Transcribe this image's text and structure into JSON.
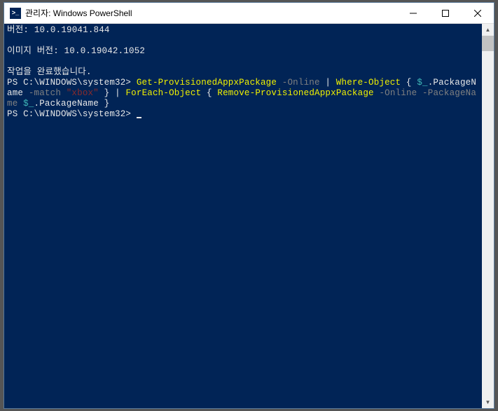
{
  "window": {
    "title": "관리자: Windows PowerShell"
  },
  "terminal": {
    "line1_label": "버전: ",
    "line1_value": "10.0.19041.844",
    "line2_label": "이미지 버전: ",
    "line2_value": "10.0.19042.1052",
    "line3": "작업을 완료했습니다.",
    "prompt1": "PS C:\\WINDOWS\\system32> ",
    "cmd1_a": "Get-ProvisionedAppxPackage",
    "cmd1_b": " -Online ",
    "cmd1_c": "| ",
    "cmd1_d": "Where-Object",
    "cmd1_e": " { ",
    "cmd1_f": "$_",
    "cmd1_g": ".PackageName ",
    "cmd1_h": "-match",
    "cmd1_i": " \"xbox\"",
    "cmd1_j": " } ",
    "cmd1_k": "| ",
    "cmd1_l": "ForEach-Object",
    "cmd1_m": " { ",
    "cmd1_n": "Remove-ProvisionedAppxPackage",
    "cmd1_o": " -Online -PackageName ",
    "cmd1_p": "$_",
    "cmd1_q": ".PackageName }",
    "prompt2": "PS C:\\WINDOWS\\system32> "
  }
}
